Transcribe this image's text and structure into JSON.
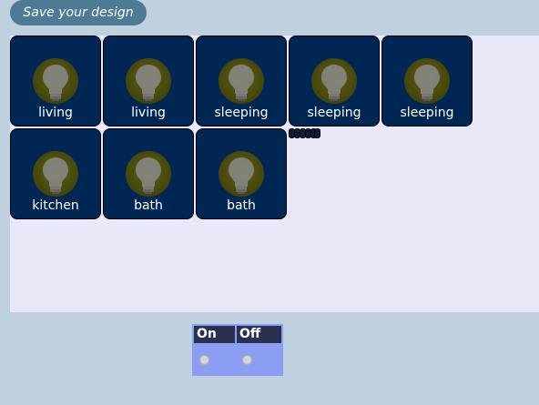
{
  "toolbar": {
    "save_label": "Save your design"
  },
  "rooms": [
    {
      "label": "living",
      "state": "off"
    },
    {
      "label": "living",
      "state": "off"
    },
    {
      "label": "sleeping",
      "state": "off"
    },
    {
      "label": "sleeping",
      "state": "off"
    },
    {
      "label": "sleeping",
      "state": "off"
    },
    {
      "label": "kitchen",
      "state": "off"
    },
    {
      "label": "bath",
      "state": "off"
    },
    {
      "label": "bath",
      "state": "off"
    }
  ],
  "tile_icon": "lightbulb-icon",
  "switch": {
    "on_label": "On",
    "off_label": "Off"
  },
  "colors": {
    "background": "#bfd1de",
    "canvas": "#e8e8f8",
    "tile": "#002654",
    "save_button": "#4d7a94",
    "switch_panel": "#8c9ef4",
    "switch_header": "#2a3050"
  }
}
